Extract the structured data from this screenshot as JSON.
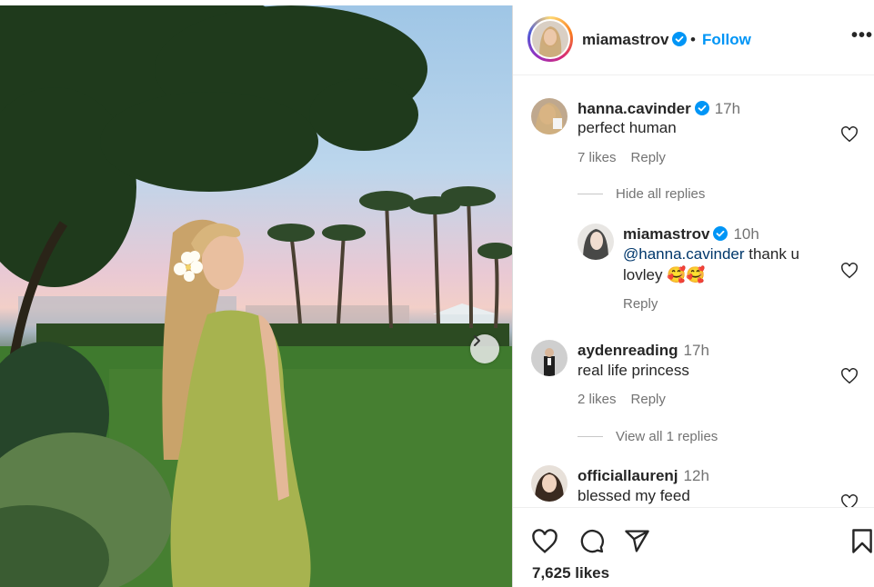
{
  "post": {
    "author": "miamastrov",
    "follow_label": "Follow",
    "separator": "•",
    "more_label": "•••",
    "likes_count": "7,625 likes"
  },
  "comments": [
    {
      "user": "hanna.cavinder",
      "verified": true,
      "time": "17h",
      "text": "perfect human",
      "likes": "7 likes",
      "reply_label": "Reply",
      "replies_toggle": "Hide all replies",
      "replies": [
        {
          "user": "miamastrov",
          "verified": true,
          "time": "10h",
          "mention": "@hanna.cavinder",
          "text_line1": " thank u",
          "text_line2": "lovley 🥰🥰",
          "reply_label": "Reply"
        }
      ]
    },
    {
      "user": "aydenreading",
      "verified": false,
      "time": "17h",
      "text": "real life princess",
      "likes": "2 likes",
      "reply_label": "Reply",
      "replies_toggle": "View all 1 replies"
    },
    {
      "user": "officiallaurenj",
      "verified": false,
      "time": "12h",
      "text": "blessed my feed"
    }
  ],
  "colors": {
    "link_blue": "#0095f6",
    "verified_blue": "#0095f6",
    "mention": "#00376b",
    "muted": "#737373"
  },
  "icons": [
    "chevron-right-icon",
    "verified-badge-icon",
    "heart-icon",
    "comment-icon",
    "share-icon",
    "bookmark-icon",
    "more-icon"
  ]
}
